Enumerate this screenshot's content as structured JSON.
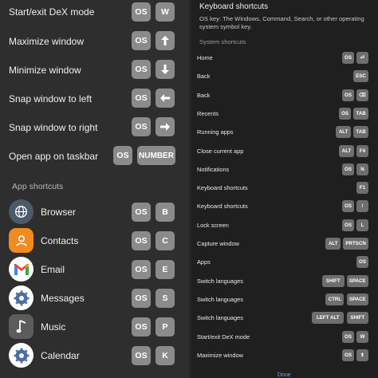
{
  "left_panel": {
    "shortcuts": [
      {
        "label": "Start/exit DeX mode",
        "key1": "OS",
        "key2_icon": "W"
      },
      {
        "label": "Maximize window",
        "key1": "OS",
        "key2_icon": "up-arrow-icon"
      },
      {
        "label": "Minimize window",
        "key1": "OS",
        "key2_icon": "down-arrow-icon"
      },
      {
        "label": "Snap window to left",
        "key1": "OS",
        "key2_icon": "left-arrow-icon"
      },
      {
        "label": "Snap window to right",
        "key1": "OS",
        "key2_icon": "right-arrow-icon"
      },
      {
        "label": "Open app on taskbar",
        "key1": "OS",
        "key2": "NUMBER"
      }
    ],
    "w_key": "W",
    "section_title": "App shortcuts",
    "apps": [
      {
        "name": "Browser",
        "key1": "OS",
        "key2": "B",
        "icon": "globe-icon"
      },
      {
        "name": "Contacts",
        "key1": "OS",
        "key2": "C",
        "icon": "person-icon"
      },
      {
        "name": "Email",
        "key1": "OS",
        "key2": "E",
        "icon": "gmail-icon"
      },
      {
        "name": "Messages",
        "key1": "OS",
        "key2": "S",
        "icon": "messages-icon"
      },
      {
        "name": "Music",
        "key1": "OS",
        "key2": "P",
        "icon": "music-note-icon"
      },
      {
        "name": "Calendar",
        "key1": "OS",
        "key2": "K",
        "icon": "calendar-gear-icon"
      }
    ]
  },
  "right_panel": {
    "title": "Keyboard shortcuts",
    "note": "OS key: The Windows, Command, Search, or other operating system symbol key.",
    "section_title": "System shortcuts",
    "rows": [
      {
        "label": "Home",
        "keys": [
          "OS",
          "⏎"
        ]
      },
      {
        "label": "Back",
        "keys": [
          "ESC"
        ]
      },
      {
        "label": "Back",
        "keys": [
          "OS",
          "⌫"
        ]
      },
      {
        "label": "Recents",
        "keys": [
          "OS",
          "TAB"
        ]
      },
      {
        "label": "Running apps",
        "keys": [
          "ALT",
          "TAB"
        ]
      },
      {
        "label": "Close current app",
        "keys": [
          "ALT",
          "F4"
        ]
      },
      {
        "label": "Notifications",
        "keys": [
          "OS",
          "N"
        ]
      },
      {
        "label": "Keyboard shortcuts",
        "keys": [
          "F1"
        ]
      },
      {
        "label": "Keyboard shortcuts",
        "keys": [
          "OS",
          "/"
        ]
      },
      {
        "label": "Lock screen",
        "keys": [
          "OS",
          "L"
        ]
      },
      {
        "label": "Capture window",
        "keys": [
          "ALT",
          "PRTSCN"
        ]
      },
      {
        "label": "Apps",
        "keys": [
          "OS"
        ]
      },
      {
        "label": "Switch languages",
        "keys": [
          "SHIFT",
          "SPACE"
        ]
      },
      {
        "label": "Switch languages",
        "keys": [
          "CTRL",
          "SPACE"
        ]
      },
      {
        "label": "Switch languages",
        "keys": [
          "LEFT ALT",
          "SHIFT"
        ]
      },
      {
        "label": "Start/exit DeX mode",
        "keys": [
          "OS",
          "W"
        ]
      },
      {
        "label": "Maximize window",
        "keys": [
          "OS",
          "⬆"
        ]
      }
    ],
    "done_label": "Done"
  },
  "colors": {
    "left_bg": "#2e2e2e",
    "right_bg": "#1f1f1f",
    "key_bg": "#8b8b8b",
    "small_key_bg": "#6e6e6e",
    "contacts_orange": "#f28a1f",
    "done_blue": "#6ea8ff"
  }
}
